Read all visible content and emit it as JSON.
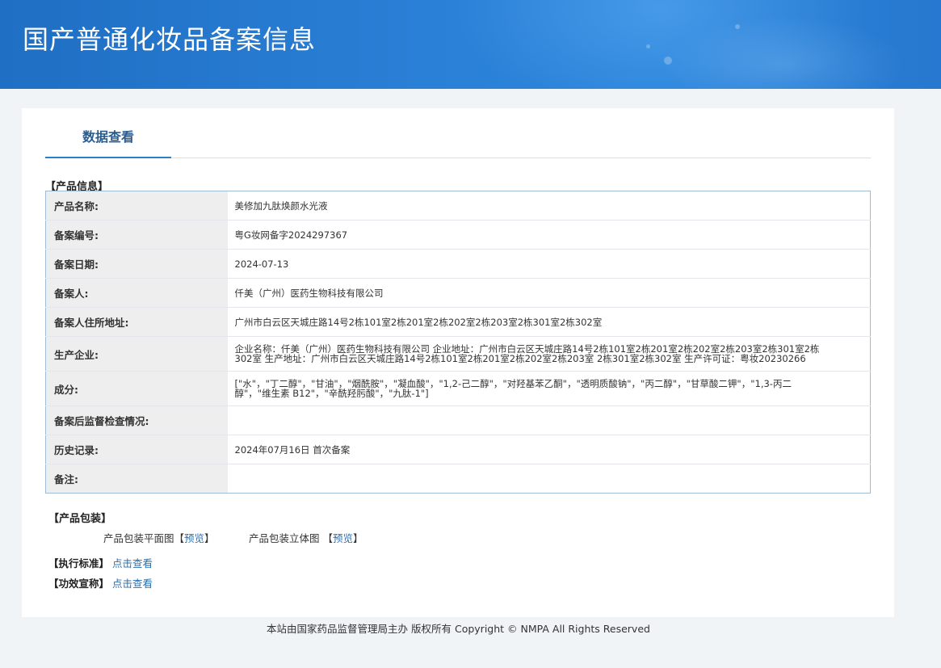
{
  "header": {
    "title": "国产普通化妆品备案信息"
  },
  "tabs": [
    {
      "label": "数据查看"
    }
  ],
  "product_info": {
    "section_title": "【产品信息】",
    "rows": [
      {
        "label": "产品名称:",
        "value": "美修加九肽焕颜水光液"
      },
      {
        "label": "备案编号:",
        "value": "粤G妆网备字2024297367"
      },
      {
        "label": "备案日期:",
        "value": "2024-07-13"
      },
      {
        "label": "备案人:",
        "value": "仟美（广州）医药生物科技有限公司"
      },
      {
        "label": "备案人住所地址:",
        "value": "广州市白云区天城庄路14号2栋101室2栋201室2栋202室2栋203室2栋301室2栋302室"
      },
      {
        "label": "生产企业:",
        "value": "企业名称：仟美（广州）医药生物科技有限公司 企业地址：广州市白云区天城庄路14号2栋101室2栋201室2栋202室2栋203室2栋301室2栋302室 生产地址：广州市白云区天城庄路14号2栋101室2栋201室2栋202室2栋203室 2栋301室2栋302室 生产许可证：粤妆20230266"
      },
      {
        "label": "成分:",
        "value": "[\"水\"，\"丁二醇\"，\"甘油\"，\"烟酰胺\"，\"凝血酸\"，\"1,2-己二醇\"，\"对羟基苯乙酮\"，\"透明质酸钠\"，\"丙二醇\"，\"甘草酸二钾\"，\"1,3-丙二醇\"，\"维生素 B12\"，\"辛酰羟肟酸\"，\"九肽-1\"]"
      },
      {
        "label": "备案后监督检查情况:",
        "value": ""
      },
      {
        "label": "历史记录:",
        "value": "2024年07月16日 首次备案"
      },
      {
        "label": "备注:",
        "value": ""
      }
    ]
  },
  "packaging": {
    "section_title": "【产品包装】",
    "flat_label": "产品包装平面图",
    "solid_label": "产品包装立体图",
    "bracket_open": "【",
    "bracket_close": "】",
    "preview_link": "预览"
  },
  "standards": {
    "label": "【执行标准】",
    "link": "点击查看"
  },
  "claims": {
    "label": "【功效宣称】",
    "link": "点击查看"
  },
  "footer": {
    "text": "本站由国家药品监督管理局主办 版权所有 Copyright © NMPA All Rights Reserved"
  }
}
